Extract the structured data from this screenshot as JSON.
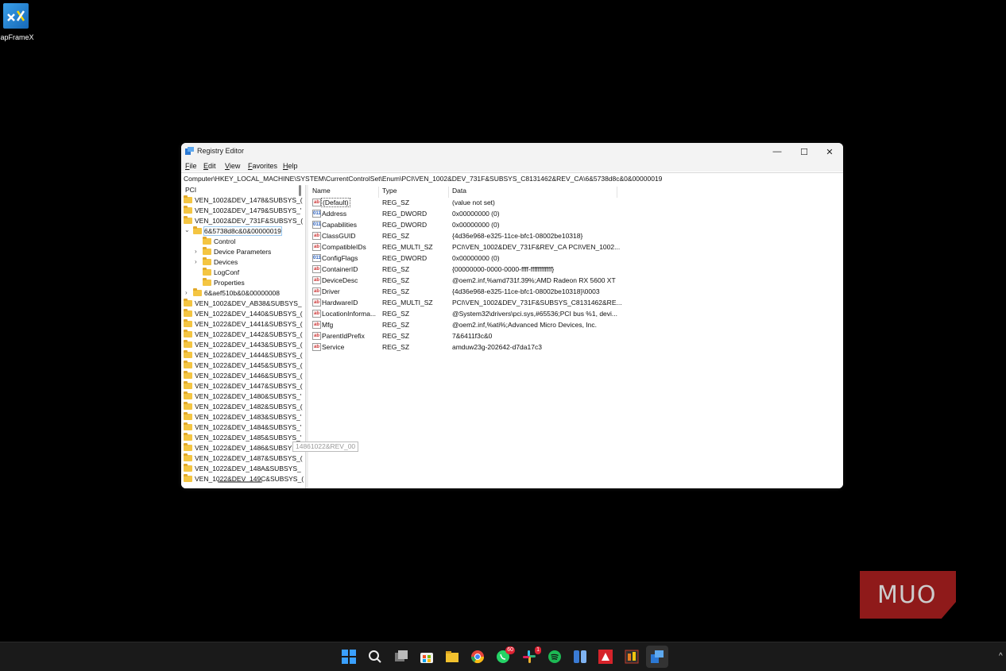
{
  "desktop": {
    "icon_label": "CapFrameX"
  },
  "window": {
    "title": "Registry Editor",
    "controls": {
      "minimize": "—",
      "maximize": "☐",
      "close": "✕"
    }
  },
  "menu": [
    "File",
    "Edit",
    "View",
    "Favorites",
    "Help"
  ],
  "address_bar": "Computer\\HKEY_LOCAL_MACHINE\\SYSTEM\\CurrentControlSet\\Enum\\PCI\\VEN_1002&DEV_731F&SUBSYS_C8131462&REV_CA\\6&5738d8c&0&00000019",
  "tree": {
    "root": "PCI",
    "items_top": [
      "VEN_1002&DEV_1478&SUBSYS_(",
      "VEN_1002&DEV_1479&SUBSYS_'",
      "VEN_1002&DEV_731F&SUBSYS_("
    ],
    "selected": "6&5738d8c&0&00000019",
    "children": [
      "Control",
      "Device Parameters",
      "Devices",
      "LogConf",
      "Properties"
    ],
    "sibling": "6&aef510b&0&00000008",
    "items_bottom": [
      "VEN_1002&DEV_AB38&SUBSYS_",
      "VEN_1022&DEV_1440&SUBSYS_(",
      "VEN_1022&DEV_1441&SUBSYS_(",
      "VEN_1022&DEV_1442&SUBSYS_(",
      "VEN_1022&DEV_1443&SUBSYS_(",
      "VEN_1022&DEV_1444&SUBSYS_(",
      "VEN_1022&DEV_1445&SUBSYS_(",
      "VEN_1022&DEV_1446&SUBSYS_(",
      "VEN_1022&DEV_1447&SUBSYS_(",
      "VEN_1022&DEV_1480&SUBSYS_'",
      "VEN_1022&DEV_1482&SUBSYS_(",
      "VEN_1022&DEV_1483&SUBSYS_'",
      "VEN_1022&DEV_1484&SUBSYS_'",
      "VEN_1022&DEV_1485&SUBSYS_'",
      "VEN_1022&DEV_1486&SUBSYS_",
      "VEN_1022&DEV_1487&SUBSYS_(",
      "VEN_1022&DEV_148A&SUBSYS_",
      "VEN_1022&DEV_149C&SUBSYS_("
    ],
    "tooltip": "14861022&REV_00"
  },
  "list": {
    "columns": [
      "Name",
      "Type",
      "Data"
    ],
    "rows": [
      {
        "name": "(Default)",
        "type": "REG_SZ",
        "data": "(value not set)",
        "icon": "ab"
      },
      {
        "name": "Address",
        "type": "REG_DWORD",
        "data": "0x00000000 (0)",
        "icon": "011"
      },
      {
        "name": "Capabilities",
        "type": "REG_DWORD",
        "data": "0x00000000 (0)",
        "icon": "011"
      },
      {
        "name": "ClassGUID",
        "type": "REG_SZ",
        "data": "{4d36e968-e325-11ce-bfc1-08002be10318}",
        "icon": "ab"
      },
      {
        "name": "CompatibleIDs",
        "type": "REG_MULTI_SZ",
        "data": "PCI\\VEN_1002&DEV_731F&REV_CA PCI\\VEN_1002...",
        "icon": "ab"
      },
      {
        "name": "ConfigFlags",
        "type": "REG_DWORD",
        "data": "0x00000000 (0)",
        "icon": "011"
      },
      {
        "name": "ContainerID",
        "type": "REG_SZ",
        "data": "{00000000-0000-0000-ffff-ffffffffffff}",
        "icon": "ab"
      },
      {
        "name": "DeviceDesc",
        "type": "REG_SZ",
        "data": "@oem2.inf,%amd731f.39%;AMD Radeon RX 5600 XT",
        "icon": "ab"
      },
      {
        "name": "Driver",
        "type": "REG_SZ",
        "data": "{4d36e968-e325-11ce-bfc1-08002be10318}\\0003",
        "icon": "ab"
      },
      {
        "name": "HardwareID",
        "type": "REG_MULTI_SZ",
        "data": "PCI\\VEN_1002&DEV_731F&SUBSYS_C8131462&RE...",
        "icon": "ab"
      },
      {
        "name": "LocationInforma...",
        "type": "REG_SZ",
        "data": "@System32\\drivers\\pci.sys,#65536;PCI bus %1, devi...",
        "icon": "ab"
      },
      {
        "name": "Mfg",
        "type": "REG_SZ",
        "data": "@oem2.inf,%ati%;Advanced Micro Devices, Inc.",
        "icon": "ab"
      },
      {
        "name": "ParentIdPrefix",
        "type": "REG_SZ",
        "data": "7&6411f3c&0",
        "icon": "ab"
      },
      {
        "name": "Service",
        "type": "REG_SZ",
        "data": "amduw23g-202642-d7da17c3",
        "icon": "ab"
      }
    ]
  },
  "watermark": "MUO",
  "taskbar": {
    "whatsapp_badge": "60",
    "slack_badge": "1",
    "colors": [
      "#0a84ff",
      "#dddddd",
      "#888888",
      "#1e6fd9",
      "#f2c12e",
      "#e8453c",
      "#25d366",
      "#e01e5a",
      "#1db954",
      "#3a7bd5",
      "#d6232a",
      "#c0392b",
      "#1f6fe0"
    ]
  }
}
